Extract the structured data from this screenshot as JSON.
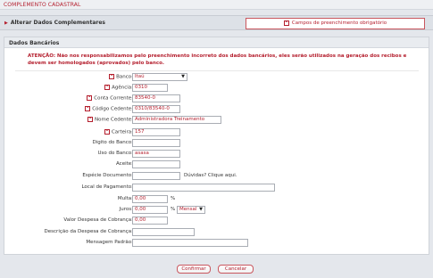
{
  "header": {
    "title": "COMPLEMENTO CADASTRAL"
  },
  "tabbar": {
    "section_label": "Alterar Dados Complementares",
    "required_notice": "Campos de preenchimento obrigatório"
  },
  "bank_panel": {
    "title": "Dados Bancários",
    "attention_prefix": "ATENÇÃO:",
    "attention_text": "Não nos responsabilizamos pelo preenchimento incorreto dos dados bancários, eles serão utilizados na geração dos recibos e devem ser homologados (aprovados) pelo banco."
  },
  "form": {
    "banco": {
      "label": "Banco:",
      "value": "Itaú"
    },
    "agencia": {
      "label": "Agência:",
      "value": "0310"
    },
    "conta_corrente": {
      "label": "Conta Corrente:",
      "value": "83540-0"
    },
    "codigo_cedente": {
      "label": "Código Cedente:",
      "value": "0310/83540-0"
    },
    "nome_cedente": {
      "label": "Nome Cedente:",
      "value": "Administradora Treinamento"
    },
    "carteira": {
      "label": "Carteira:",
      "value": "157"
    },
    "digito_banco": {
      "label": "Digito do Banco:",
      "value": ""
    },
    "uso_banco": {
      "label": "Uso do Banco:",
      "value": "asasa"
    },
    "aceite": {
      "label": "Aceite:",
      "value": ""
    },
    "especie_documento": {
      "label": "Espécie Documento:",
      "value": "",
      "help": "Dúvidas? Clique aqui."
    },
    "local_pagamento": {
      "label": "Local de Pagamento:",
      "value": ""
    },
    "multa": {
      "label": "Multa:",
      "value": "0,00",
      "unit": "%"
    },
    "juros": {
      "label": "Juros:",
      "value": "0,00",
      "unit": "%",
      "period": "Mensal"
    },
    "valor_despesa": {
      "label": "Valor Despesa de Cobrança:",
      "value": "0,00"
    },
    "descricao_despesa": {
      "label": "Descrição da Despesa de Cobrança:",
      "value": ""
    },
    "mensagem_padrao": {
      "label": "Mensagem Padrão:",
      "value": ""
    }
  },
  "actions": {
    "confirm": "Confirmar",
    "cancel": "Cancelar"
  },
  "colors": {
    "accent": "#b41e2d",
    "background": "#e4e7ec",
    "panel": "#ffffff"
  }
}
